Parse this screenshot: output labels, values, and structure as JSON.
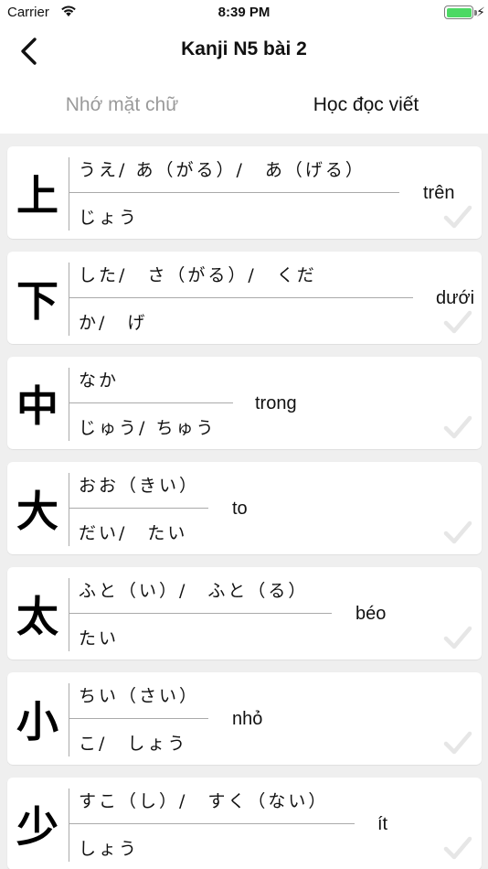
{
  "status_bar": {
    "carrier": "Carrier",
    "time": "8:39 PM"
  },
  "nav": {
    "title": "Kanji N5 bài 2"
  },
  "tabs": {
    "remember": "Nhớ mặt chữ",
    "learn": "Học đọc viết"
  },
  "cards": [
    {
      "kanji": "上",
      "kun": "うえ/ あ（がる）/　あ（げる）",
      "on": "じょう",
      "meaning": "trên"
    },
    {
      "kanji": "下",
      "kun": "した/　さ（がる）/　くだ",
      "on": "か/　げ",
      "meaning": "dưới"
    },
    {
      "kanji": "中",
      "kun": "なか",
      "on": "じゅう/ ちゅう",
      "meaning": "trong"
    },
    {
      "kanji": "大",
      "kun": "おお（きい）",
      "on": "だい/　たい",
      "meaning": "to"
    },
    {
      "kanji": "太",
      "kun": "ふと（い）/　ふと（る）",
      "on": "たい",
      "meaning": "béo"
    },
    {
      "kanji": "小",
      "kun": "ちい（さい）",
      "on": "こ/　しょう",
      "meaning": "nhỏ"
    },
    {
      "kanji": "少",
      "kun": "すこ（し）/　すく（ない）",
      "on": "しょう",
      "meaning": "ít"
    }
  ]
}
